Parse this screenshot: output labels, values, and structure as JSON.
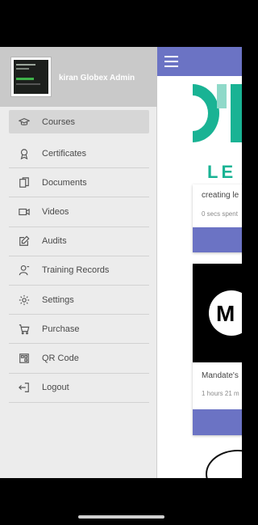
{
  "user": {
    "name": "kiran Globex Admin"
  },
  "menu": [
    {
      "label": "Courses",
      "icon": "graduation-cap-icon",
      "active": true
    },
    {
      "label": "Certificates",
      "icon": "award-icon",
      "active": false
    },
    {
      "label": "Documents",
      "icon": "documents-icon",
      "active": false
    },
    {
      "label": "Videos",
      "icon": "video-icon",
      "active": false
    },
    {
      "label": "Audits",
      "icon": "edit-icon",
      "active": false
    },
    {
      "label": "Training Records",
      "icon": "user-record-icon",
      "active": false
    },
    {
      "label": "Settings",
      "icon": "gear-icon",
      "active": false
    },
    {
      "label": "Purchase",
      "icon": "cart-icon",
      "active": false
    },
    {
      "label": "QR Code",
      "icon": "qr-code-icon",
      "active": false
    },
    {
      "label": "Logout",
      "icon": "logout-icon",
      "active": false
    }
  ],
  "main": {
    "logo_text": "LE",
    "cards": [
      {
        "title": "creating le",
        "meta": "0 secs spent"
      },
      {
        "title": "Mandate's",
        "meta": "1 hours 21 m",
        "thumb_letter": "M"
      }
    ]
  },
  "colors": {
    "accent": "#6b73c4",
    "brand_teal": "#19b394",
    "drawer_bg": "#ececec",
    "drawer_header_bg": "#c9c9c9"
  }
}
